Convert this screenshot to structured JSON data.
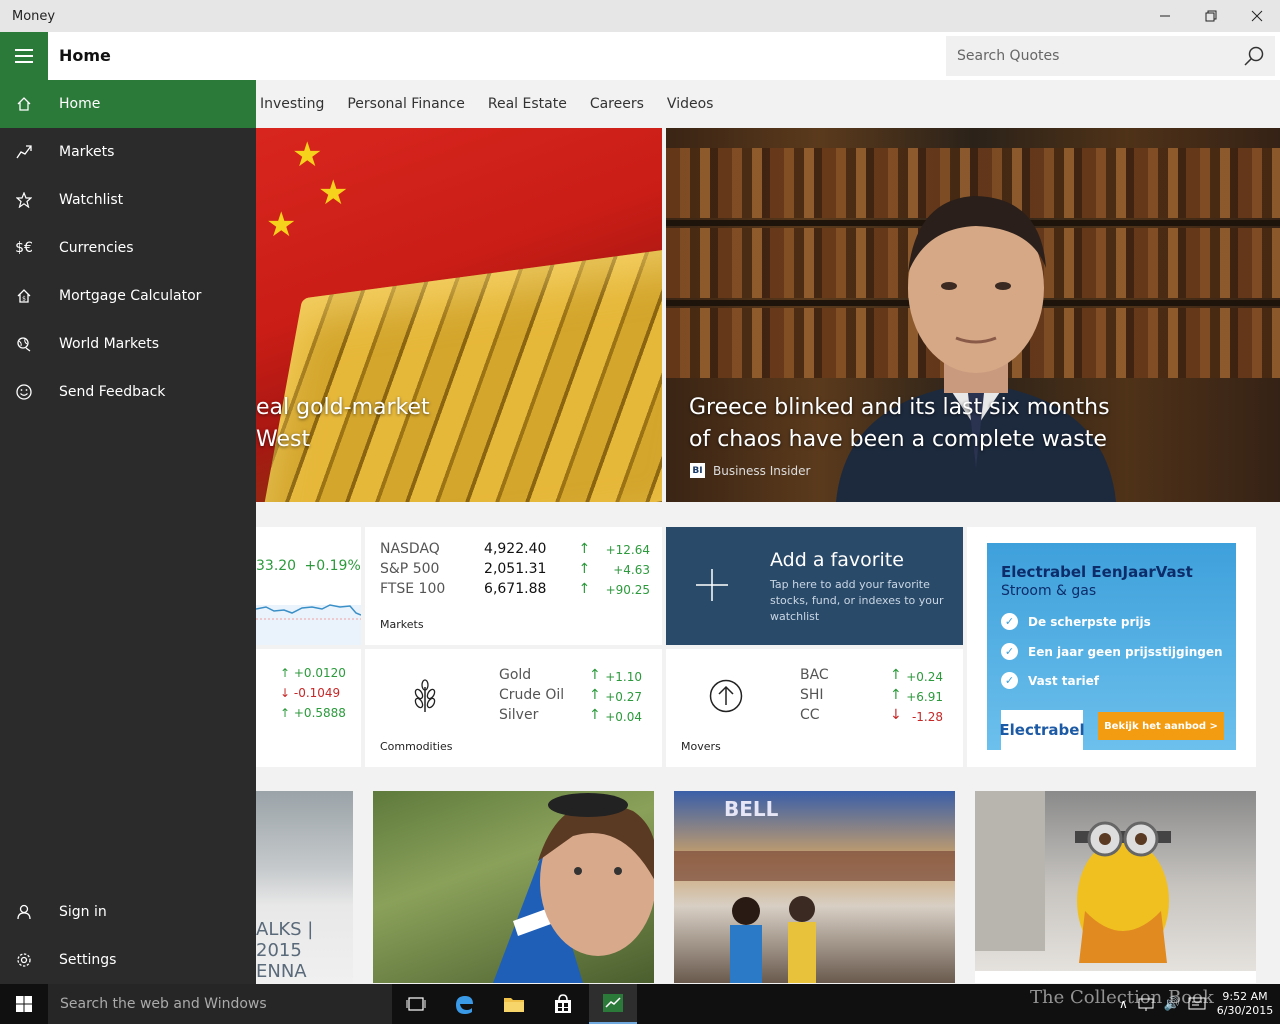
{
  "window": {
    "title": "Money",
    "controls": [
      "minimize",
      "restore",
      "close"
    ]
  },
  "header": {
    "page_title": "Home",
    "search_placeholder": "Search Quotes"
  },
  "tabs": [
    {
      "label": "Investing"
    },
    {
      "label": "Personal Finance"
    },
    {
      "label": "Real Estate"
    },
    {
      "label": "Careers"
    },
    {
      "label": "Videos"
    }
  ],
  "hero": {
    "left": {
      "headline_line1": "eal gold-market",
      "headline_line2": "West"
    },
    "right": {
      "headline_line1": "Greece blinked and its last six months",
      "headline_line2": "of chaos have been a complete waste",
      "source_logo": "BI",
      "source": "Business Insider"
    }
  },
  "partial_index_tile": {
    "value": "33.20",
    "change": "+0.19%"
  },
  "partial_currency_tile": {
    "rows": [
      {
        "change": "+0.0120",
        "direction": "up"
      },
      {
        "change": "-0.1049",
        "direction": "down"
      },
      {
        "change": "+0.5888",
        "direction": "up"
      }
    ]
  },
  "markets_tile": {
    "label": "Markets",
    "rows": [
      {
        "name": "NASDAQ",
        "value": "4,922.40",
        "arrow": "↑",
        "change": "+12.64",
        "direction": "up"
      },
      {
        "name": "S&P 500",
        "value": "2,051.31",
        "arrow": "↑",
        "change": "+4.63",
        "direction": "up"
      },
      {
        "name": "FTSE 100",
        "value": "6,671.88",
        "arrow": "↑",
        "change": "+90.25",
        "direction": "up"
      }
    ]
  },
  "favorite_tile": {
    "title": "Add a favorite",
    "description": "Tap here to add your favorite stocks, fund, or indexes to your watchlist"
  },
  "commodities_tile": {
    "label": "Commodities",
    "rows": [
      {
        "name": "Gold",
        "arrow": "↑",
        "change": "+1.10",
        "direction": "up"
      },
      {
        "name": "Crude Oil",
        "arrow": "↑",
        "change": "+0.27",
        "direction": "up"
      },
      {
        "name": "Silver",
        "arrow": "↑",
        "change": "+0.04",
        "direction": "up"
      }
    ]
  },
  "movers_tile": {
    "label": "Movers",
    "rows": [
      {
        "name": "BAC",
        "arrow": "↑",
        "change": "+0.24",
        "direction": "up"
      },
      {
        "name": "SHI",
        "arrow": "↑",
        "change": "+6.91",
        "direction": "up"
      },
      {
        "name": "CC",
        "arrow": "↓",
        "change": "-1.28",
        "direction": "down"
      }
    ]
  },
  "ad": {
    "title": "Electrabel EenJaarVast",
    "subtitle": "Stroom & gas",
    "items": [
      "De scherpste prijs",
      "Een jaar geen prijsstijgingen",
      "Vast tarief"
    ],
    "brand": "Electrabel",
    "cta": "Bekijk het aanbod  >"
  },
  "bottom_photos": {
    "photo1_text_line1": "ALKS | 2015",
    "photo1_text_line2": "ENNA",
    "photo3_sign": "BELL"
  },
  "nav": {
    "items": [
      {
        "label": "Home",
        "icon": "home-icon",
        "glyph": "⌂",
        "active": true
      },
      {
        "label": "Markets",
        "icon": "trend-icon",
        "glyph": "↗",
        "active": false
      },
      {
        "label": "Watchlist",
        "icon": "star-icon",
        "glyph": "☆",
        "active": false
      },
      {
        "label": "Currencies",
        "icon": "currency-icon",
        "glyph": "$€",
        "active": false
      },
      {
        "label": "Mortgage Calculator",
        "icon": "house-dollar-icon",
        "glyph": "⌂",
        "active": false
      },
      {
        "label": "World Markets",
        "icon": "globe-icon",
        "glyph": "🌐",
        "active": false
      },
      {
        "label": "Send Feedback",
        "icon": "smiley-icon",
        "glyph": "☺",
        "active": false
      }
    ],
    "footer": [
      {
        "label": "Sign in",
        "icon": "person-icon",
        "glyph": "👤"
      },
      {
        "label": "Settings",
        "icon": "gear-icon",
        "glyph": "⚙"
      }
    ]
  },
  "taskbar": {
    "search_placeholder": "Search the web and Windows",
    "time": "9:52 AM",
    "date": "6/30/2015",
    "watermark": "The Collection Book"
  },
  "colors": {
    "accent_green": "#2c7a3a",
    "nav_bg": "#2b2b2b",
    "up": "#2c9a3c",
    "down": "#c62828",
    "favorite_bg": "#2a4a6a"
  }
}
